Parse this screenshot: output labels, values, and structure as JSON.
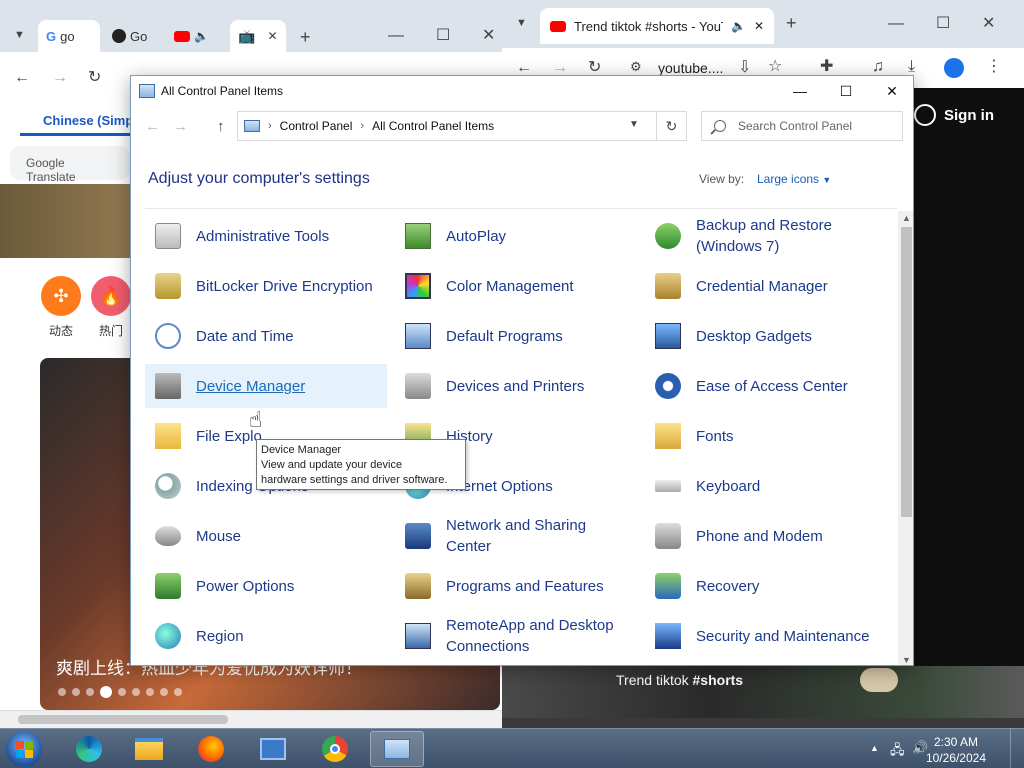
{
  "left_browser": {
    "tabs": [
      {
        "label": "go"
      },
      {
        "label": "Go"
      }
    ],
    "translate_tab": "Chinese (Simplified)",
    "translate_pill": "Google Translate",
    "bilibili_nav": [
      {
        "label": "动态"
      },
      {
        "label": "热门"
      }
    ],
    "feature_caption": "爽剧上线：热血少年为爱忧成为妖详师！"
  },
  "right_browser": {
    "tab_title": "Trend tiktok #shorts - YouT",
    "url": "youtube....",
    "sign_in": "Sign in",
    "video_title_prefix": "Trend tiktok ",
    "video_title_tag": "#shorts"
  },
  "control_panel": {
    "window_title": "All Control Panel Items",
    "breadcrumb": [
      "Control Panel",
      "All Control Panel Items"
    ],
    "search_placeholder": "Search Control Panel",
    "heading": "Adjust your computer's settings",
    "view_by_label": "View by:",
    "view_by_value": "Large icons",
    "items": [
      {
        "label": "Administrative Tools",
        "icon": "administrative-tools-icon"
      },
      {
        "label": "AutoPlay",
        "icon": "autoplay-icon"
      },
      {
        "label": "Backup and Restore (Windows 7)",
        "icon": "backup-restore-icon"
      },
      {
        "label": "BitLocker Drive Encryption",
        "icon": "bitlocker-icon"
      },
      {
        "label": "Color Management",
        "icon": "color-management-icon"
      },
      {
        "label": "Credential Manager",
        "icon": "credential-manager-icon"
      },
      {
        "label": "Date and Time",
        "icon": "date-time-icon"
      },
      {
        "label": "Default Programs",
        "icon": "default-programs-icon"
      },
      {
        "label": "Desktop Gadgets",
        "icon": "desktop-gadgets-icon"
      },
      {
        "label": "Device Manager",
        "icon": "device-manager-icon"
      },
      {
        "label": "Devices and Printers",
        "icon": "devices-printers-icon"
      },
      {
        "label": "Ease of Access Center",
        "icon": "ease-of-access-icon"
      },
      {
        "label": "File Explo",
        "icon": "file-explorer-icon"
      },
      {
        "label": "History",
        "icon": "file-history-icon"
      },
      {
        "label": "Fonts",
        "icon": "fonts-icon"
      },
      {
        "label": "Indexing Options",
        "icon": "indexing-options-icon"
      },
      {
        "label": "Internet Options",
        "icon": "internet-options-icon"
      },
      {
        "label": "Keyboard",
        "icon": "keyboard-icon"
      },
      {
        "label": "Mouse",
        "icon": "mouse-icon"
      },
      {
        "label": "Network and Sharing Center",
        "icon": "network-sharing-icon"
      },
      {
        "label": "Phone and Modem",
        "icon": "phone-modem-icon"
      },
      {
        "label": "Power Options",
        "icon": "power-options-icon"
      },
      {
        "label": "Programs and Features",
        "icon": "programs-features-icon"
      },
      {
        "label": "Recovery",
        "icon": "recovery-icon"
      },
      {
        "label": "Region",
        "icon": "region-icon"
      },
      {
        "label": "RemoteApp and Desktop Connections",
        "icon": "remoteapp-icon"
      },
      {
        "label": "Security and Maintenance",
        "icon": "security-maintenance-icon"
      }
    ],
    "tooltip": {
      "title": "Device Manager",
      "line1": "View and update your device",
      "line2": "hardware settings and driver software."
    }
  },
  "taskbar": {
    "time": "2:30 AM",
    "date": "10/26/2024"
  }
}
